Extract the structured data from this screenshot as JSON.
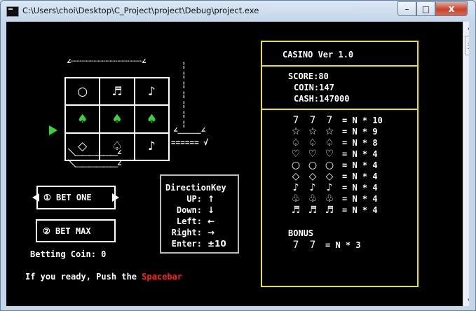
{
  "window": {
    "title": "C:\\Users\\choi\\Desktop\\C_Project\\project\\Debug\\project.exe",
    "buttons": {
      "minimize": "–",
      "maximize": "□",
      "close": "x"
    }
  },
  "machine": {
    "top_art": "∠┈┈┈┈┈┈┈┈┈┈┈┈┈┈┈┈┈┈∠",
    "reels": [
      [
        "○",
        "♬",
        "♪"
      ],
      [
        "♠",
        "♠",
        "♠"
      ],
      [
        "◇",
        "♤",
        "♪"
      ]
    ],
    "side_art_top": "∠＿＿＿∠",
    "side_art_lever": "====== √",
    "base_art_1": "＼＿＿＿＿＿＿∠",
    "base_art_2": "＼＿＿＿＿＿＿∠"
  },
  "controls": {
    "bet_one": "① BET ONE",
    "bet_max": "② BET MAX",
    "betting_coin": "Betting Coin: 0",
    "ready_prefix": "If you ready, Push the ",
    "ready_key": "Spacebar"
  },
  "direction_key": {
    "title": "DirectionKey",
    "rows": [
      {
        "label": "UP:",
        "value": "↑"
      },
      {
        "label": "Down:",
        "value": "↓"
      },
      {
        "label": "Left:",
        "value": "←"
      },
      {
        "label": "Right:",
        "value": "→"
      },
      {
        "label": "Enter:",
        "value": "±10"
      }
    ]
  },
  "casino": {
    "title": "CASINO Ver 1.0",
    "score": "SCORE:80",
    "coin": "COIN:147",
    "cash": "CASH:147000",
    "paytable": [
      {
        "symbols": [
          "7",
          "7",
          "7"
        ],
        "payout": "= N * 10"
      },
      {
        "symbols": [
          "☆",
          "☆",
          "☆"
        ],
        "payout": "= N * 9"
      },
      {
        "symbols": [
          "♤",
          "♤",
          "♤"
        ],
        "payout": "= N * 8"
      },
      {
        "symbols": [
          "♡",
          "♡",
          "♡"
        ],
        "payout": "= N * 4"
      },
      {
        "symbols": [
          "○",
          "○",
          "○"
        ],
        "payout": "= N * 4"
      },
      {
        "symbols": [
          "◇",
          "◇",
          "◇"
        ],
        "payout": "= N * 4"
      },
      {
        "symbols": [
          "♪",
          "♪",
          "♪"
        ],
        "payout": "= N * 4"
      },
      {
        "symbols": [
          "♧",
          "♧",
          "♧"
        ],
        "payout": "= N * 4"
      },
      {
        "symbols": [
          "♬",
          "♬",
          "♬"
        ],
        "payout": "= N * 4"
      }
    ],
    "bonus_label": "BONUS",
    "bonus": {
      "symbols": [
        "7",
        "7"
      ],
      "payout": "= N * 3"
    }
  },
  "colors": {
    "highlight": "#39d239",
    "frame": "#e6e12c",
    "keyword": "#ff2020"
  }
}
